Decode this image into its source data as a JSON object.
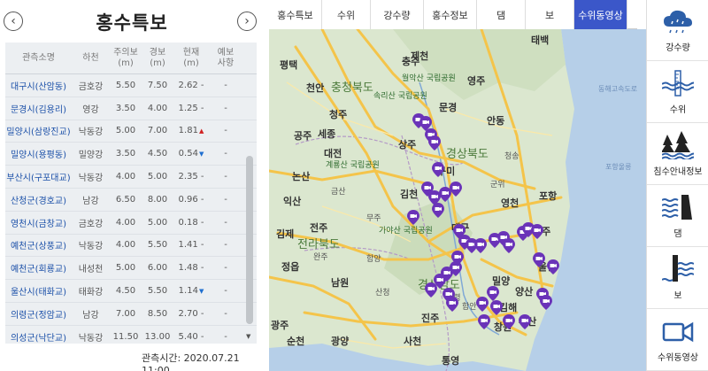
{
  "panel": {
    "title": "홍수특보",
    "prev_glyph": "‹",
    "next_glyph": "›",
    "headers": [
      "관측소명",
      "하천",
      "주의보\n(m)",
      "경보\n(m)",
      "현재\n(m)",
      "예보\n사항"
    ],
    "rows": [
      {
        "station": "대구시(산암동)",
        "river": "금호강",
        "watch": "5.50",
        "warn": "7.50",
        "now": "2.62",
        "trend": "-",
        "forecast": "-"
      },
      {
        "station": "문경시(김용리)",
        "river": "영강",
        "watch": "3.50",
        "warn": "4.00",
        "now": "1.25",
        "trend": "-",
        "forecast": "-"
      },
      {
        "station": "밀양시(삼랑진교)",
        "river": "낙동강",
        "watch": "5.00",
        "warn": "7.00",
        "now": "1.81",
        "trend": "▲",
        "forecast": "-"
      },
      {
        "station": "밀양시(용평동)",
        "river": "밀양강",
        "watch": "3.50",
        "warn": "4.50",
        "now": "0.54",
        "trend": "▼",
        "forecast": "-"
      },
      {
        "station": "부산시(구포대교)",
        "river": "낙동강",
        "watch": "4.00",
        "warn": "5.00",
        "now": "2.35",
        "trend": "-",
        "forecast": "-"
      },
      {
        "station": "산청군(경호교)",
        "river": "남강",
        "watch": "6.50",
        "warn": "8.00",
        "now": "0.96",
        "trend": "-",
        "forecast": "-"
      },
      {
        "station": "영천시(금창교)",
        "river": "금호강",
        "watch": "4.00",
        "warn": "5.00",
        "now": "0.18",
        "trend": "-",
        "forecast": "-"
      },
      {
        "station": "예천군(상풍교)",
        "river": "낙동강",
        "watch": "4.00",
        "warn": "5.50",
        "now": "1.41",
        "trend": "-",
        "forecast": "-"
      },
      {
        "station": "예천군(회룡교)",
        "river": "내성천",
        "watch": "5.00",
        "warn": "6.00",
        "now": "1.48",
        "trend": "-",
        "forecast": "-"
      },
      {
        "station": "울산시(태화교)",
        "river": "태화강",
        "watch": "4.50",
        "warn": "5.50",
        "now": "1.14",
        "trend": "▼",
        "forecast": "-"
      },
      {
        "station": "의령군(정암교)",
        "river": "남강",
        "watch": "7.00",
        "warn": "8.50",
        "now": "2.70",
        "trend": "-",
        "forecast": "-"
      },
      {
        "station": "의성군(낙단교)",
        "river": "낙동강",
        "watch": "11.50",
        "warn": "13.00",
        "now": "5.40",
        "trend": "-",
        "forecast": "-"
      }
    ],
    "obs_time": "관측시간: 2020.07.21 11:00"
  },
  "tabs": [
    {
      "label": "홍수특보",
      "active": false
    },
    {
      "label": "수위",
      "active": false
    },
    {
      "label": "강수량",
      "active": false
    },
    {
      "label": "홍수정보",
      "active": false
    },
    {
      "label": "댐",
      "active": false
    },
    {
      "label": "보",
      "active": false
    },
    {
      "label": "수위동영상",
      "active": true
    }
  ],
  "map": {
    "labels": [
      {
        "text": "충주",
        "cls": ""
      },
      {
        "text": "제천",
        "cls": ""
      },
      {
        "text": "태백",
        "cls": ""
      },
      {
        "text": "평택",
        "cls": ""
      },
      {
        "text": "월악산 국립공원",
        "cls": "park"
      },
      {
        "text": "영주",
        "cls": ""
      },
      {
        "text": "천안",
        "cls": ""
      },
      {
        "text": "충청북도",
        "cls": "big"
      },
      {
        "text": "속리산 국립공원",
        "cls": "park"
      },
      {
        "text": "문경",
        "cls": ""
      },
      {
        "text": "안동",
        "cls": ""
      },
      {
        "text": "청주",
        "cls": ""
      },
      {
        "text": "공주",
        "cls": ""
      },
      {
        "text": "세종",
        "cls": ""
      },
      {
        "text": "상주",
        "cls": ""
      },
      {
        "text": "경상북도",
        "cls": "big"
      },
      {
        "text": "청송",
        "cls": "small"
      },
      {
        "text": "대전",
        "cls": ""
      },
      {
        "text": "계룡산 국립공원",
        "cls": "park"
      },
      {
        "text": "구미",
        "cls": ""
      },
      {
        "text": "논산",
        "cls": ""
      },
      {
        "text": "김천",
        "cls": ""
      },
      {
        "text": "군위",
        "cls": "small"
      },
      {
        "text": "영천",
        "cls": ""
      },
      {
        "text": "포항",
        "cls": ""
      },
      {
        "text": "익산",
        "cls": ""
      },
      {
        "text": "전주",
        "cls": ""
      },
      {
        "text": "대구",
        "cls": ""
      },
      {
        "text": "경주",
        "cls": ""
      },
      {
        "text": "김제",
        "cls": ""
      },
      {
        "text": "전라북도",
        "cls": "big"
      },
      {
        "text": "가야산 국립공원",
        "cls": "park"
      },
      {
        "text": "정읍",
        "cls": ""
      },
      {
        "text": "울산",
        "cls": ""
      },
      {
        "text": "남원",
        "cls": ""
      },
      {
        "text": "밀양",
        "cls": ""
      },
      {
        "text": "경상남도",
        "cls": "big"
      },
      {
        "text": "양산",
        "cls": ""
      },
      {
        "text": "김해",
        "cls": ""
      },
      {
        "text": "진주",
        "cls": ""
      },
      {
        "text": "부산",
        "cls": ""
      },
      {
        "text": "광주",
        "cls": ""
      },
      {
        "text": "광양",
        "cls": ""
      },
      {
        "text": "순천",
        "cls": ""
      },
      {
        "text": "사천",
        "cls": ""
      },
      {
        "text": "창원",
        "cls": ""
      },
      {
        "text": "통영",
        "cls": ""
      },
      {
        "text": "금산",
        "cls": "small"
      },
      {
        "text": "완주",
        "cls": "small"
      },
      {
        "text": "무주",
        "cls": "small"
      },
      {
        "text": "함양",
        "cls": "small"
      },
      {
        "text": "산청",
        "cls": "small"
      },
      {
        "text": "의령",
        "cls": "small"
      },
      {
        "text": "함안",
        "cls": "small"
      },
      {
        "text": "동해고속도로",
        "cls": "sea"
      },
      {
        "text": "포항울릉",
        "cls": "sea"
      }
    ],
    "cameras": 38
  },
  "sidebar": [
    {
      "label": "강수량",
      "icon": "rain-cloud-icon"
    },
    {
      "label": "수위",
      "icon": "water-level-icon"
    },
    {
      "label": "침수안내정보",
      "icon": "flood-info-icon"
    },
    {
      "label": "댐",
      "icon": "dam-icon"
    },
    {
      "label": "보",
      "icon": "weir-icon"
    },
    {
      "label": "수위동영상",
      "icon": "video-camera-icon"
    }
  ],
  "colors": {
    "accent": "#3b57c9",
    "sidebar_icon": "#2d5fa8",
    "camera": "#6a33b8",
    "road": "#f4c44a",
    "sea": "#b6cfe8"
  }
}
